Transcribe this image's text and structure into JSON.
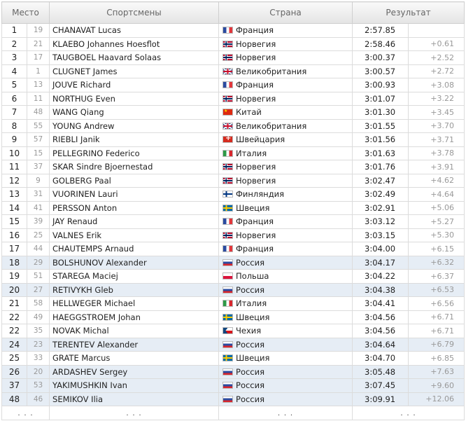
{
  "header": {
    "place": "Место",
    "athletes": "Спортсмены",
    "country": "Страна",
    "result": "Результат"
  },
  "rows": [
    {
      "place": "1",
      "bib": "19",
      "name": "CHANAVAT Lucas",
      "country": "Франция",
      "flag": "fr",
      "time": "2:57.85",
      "gap": "",
      "highlight": false
    },
    {
      "place": "2",
      "bib": "21",
      "name": "KLAEBO Johannes Hoesflot",
      "country": "Норвегия",
      "flag": "no",
      "time": "2:58.46",
      "gap": "+0.61",
      "highlight": false
    },
    {
      "place": "3",
      "bib": "17",
      "name": "TAUGBOEL Haavard Solaas",
      "country": "Норвегия",
      "flag": "no",
      "time": "3:00.37",
      "gap": "+2.52",
      "highlight": false
    },
    {
      "place": "4",
      "bib": "1",
      "name": "CLUGNET James",
      "country": "Великобритания",
      "flag": "gb",
      "time": "3:00.57",
      "gap": "+2.72",
      "highlight": false
    },
    {
      "place": "5",
      "bib": "13",
      "name": "JOUVE Richard",
      "country": "Франция",
      "flag": "fr",
      "time": "3:00.93",
      "gap": "+3.08",
      "highlight": false
    },
    {
      "place": "6",
      "bib": "11",
      "name": "NORTHUG Even",
      "country": "Норвегия",
      "flag": "no",
      "time": "3:01.07",
      "gap": "+3.22",
      "highlight": false
    },
    {
      "place": "7",
      "bib": "48",
      "name": "WANG Qiang",
      "country": "Китай",
      "flag": "cn",
      "time": "3:01.30",
      "gap": "+3.45",
      "highlight": false
    },
    {
      "place": "8",
      "bib": "55",
      "name": "YOUNG Andrew",
      "country": "Великобритания",
      "flag": "gb",
      "time": "3:01.55",
      "gap": "+3.70",
      "highlight": false
    },
    {
      "place": "9",
      "bib": "57",
      "name": "RIEBLI Janik",
      "country": "Швейцария",
      "flag": "ch",
      "time": "3:01.56",
      "gap": "+3.71",
      "highlight": false
    },
    {
      "place": "10",
      "bib": "15",
      "name": "PELLEGRINO Federico",
      "country": "Италия",
      "flag": "it",
      "time": "3:01.63",
      "gap": "+3.78",
      "highlight": false
    },
    {
      "place": "11",
      "bib": "37",
      "name": "SKAR Sindre Bjoernestad",
      "country": "Норвегия",
      "flag": "no",
      "time": "3:01.76",
      "gap": "+3.91",
      "highlight": false
    },
    {
      "place": "12",
      "bib": "9",
      "name": "GOLBERG Paal",
      "country": "Норвегия",
      "flag": "no",
      "time": "3:02.47",
      "gap": "+4.62",
      "highlight": false
    },
    {
      "place": "13",
      "bib": "31",
      "name": "VUORINEN Lauri",
      "country": "Финляндия",
      "flag": "fi",
      "time": "3:02.49",
      "gap": "+4.64",
      "highlight": false
    },
    {
      "place": "14",
      "bib": "41",
      "name": "PERSSON Anton",
      "country": "Швеция",
      "flag": "se",
      "time": "3:02.91",
      "gap": "+5.06",
      "highlight": false
    },
    {
      "place": "15",
      "bib": "39",
      "name": "JAY Renaud",
      "country": "Франция",
      "flag": "fr",
      "time": "3:03.12",
      "gap": "+5.27",
      "highlight": false
    },
    {
      "place": "16",
      "bib": "25",
      "name": "VALNES Erik",
      "country": "Норвегия",
      "flag": "no",
      "time": "3:03.15",
      "gap": "+5.30",
      "highlight": false
    },
    {
      "place": "17",
      "bib": "44",
      "name": "CHAUTEMPS Arnaud",
      "country": "Франция",
      "flag": "fr",
      "time": "3:04.00",
      "gap": "+6.15",
      "highlight": false
    },
    {
      "place": "18",
      "bib": "29",
      "name": "BOLSHUNOV Alexander",
      "country": "Россия",
      "flag": "ru",
      "time": "3:04.17",
      "gap": "+6.32",
      "highlight": true
    },
    {
      "place": "19",
      "bib": "51",
      "name": "STAREGA Maciej",
      "country": "Польша",
      "flag": "pl",
      "time": "3:04.22",
      "gap": "+6.37",
      "highlight": false
    },
    {
      "place": "20",
      "bib": "27",
      "name": "RETIVYKH Gleb",
      "country": "Россия",
      "flag": "ru",
      "time": "3:04.38",
      "gap": "+6.53",
      "highlight": true
    },
    {
      "place": "21",
      "bib": "58",
      "name": "HELLWEGER Michael",
      "country": "Италия",
      "flag": "it",
      "time": "3:04.41",
      "gap": "+6.56",
      "highlight": false
    },
    {
      "place": "22",
      "bib": "49",
      "name": "HAEGGSTROEM Johan",
      "country": "Швеция",
      "flag": "se",
      "time": "3:04.56",
      "gap": "+6.71",
      "highlight": false
    },
    {
      "place": "22",
      "bib": "35",
      "name": "NOVAK Michal",
      "country": "Чехия",
      "flag": "cz",
      "time": "3:04.56",
      "gap": "+6.71",
      "highlight": false
    },
    {
      "place": "24",
      "bib": "23",
      "name": "TERENTEV Alexander",
      "country": "Россия",
      "flag": "ru",
      "time": "3:04.64",
      "gap": "+6.79",
      "highlight": true
    },
    {
      "place": "25",
      "bib": "33",
      "name": "GRATE Marcus",
      "country": "Швеция",
      "flag": "se",
      "time": "3:04.70",
      "gap": "+6.85",
      "highlight": false
    },
    {
      "place": "26",
      "bib": "20",
      "name": "ARDASHEV Sergey",
      "country": "Россия",
      "flag": "ru",
      "time": "3:05.48",
      "gap": "+7.63",
      "highlight": true
    },
    {
      "place": "37",
      "bib": "53",
      "name": "YAKIMUSHKIN Ivan",
      "country": "Россия",
      "flag": "ru",
      "time": "3:07.45",
      "gap": "+9.60",
      "highlight": true
    },
    {
      "place": "48",
      "bib": "46",
      "name": "SEMIKOV Ilia",
      "country": "Россия",
      "flag": "ru",
      "time": "3:09.91",
      "gap": "+12.06",
      "highlight": true
    }
  ],
  "footer": {
    "place": ". . .",
    "athletes": ". . .",
    "country": ". . .",
    "result": ". . ."
  },
  "colors": {
    "highlight_row": "#e6edf5",
    "header_bg_top": "#f9f9f9",
    "header_bg_bottom": "#e4e4e4",
    "border": "#dcdcdc",
    "muted_text": "#999999"
  }
}
